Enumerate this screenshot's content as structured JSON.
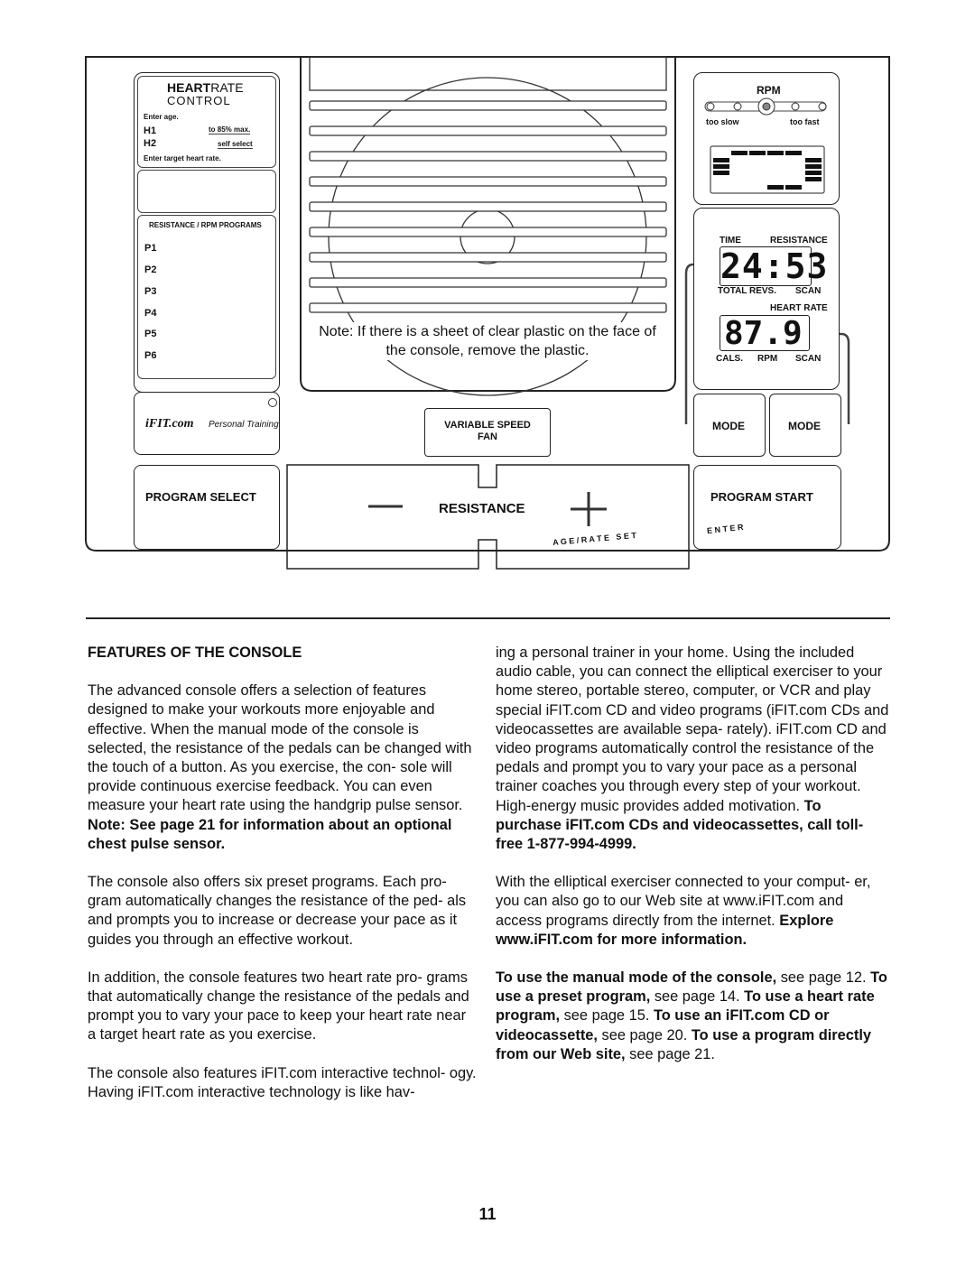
{
  "console": {
    "heart_rate": {
      "title_bold": "HEART",
      "title_light": "RATE",
      "subtitle": "CONTROL",
      "enter_age": "Enter age.",
      "h1": "H1",
      "h1_desc": "to 85% max.",
      "h2": "H2",
      "h2_desc": "self select",
      "enter_target": "Enter target heart rate."
    },
    "programs": {
      "title": "RESISTANCE / RPM PROGRAMS",
      "items": [
        "P1",
        "P2",
        "P3",
        "P4",
        "P5",
        "P6"
      ]
    },
    "note": "Note: If there is a sheet of clear plastic on the face of the console, remove the plastic.",
    "ifit_logo": "iFIT.com",
    "ifit_tagline": "Personal Training",
    "fan_button": "VARIABLE SPEED FAN",
    "program_select": "PROGRAM SELECT",
    "resistance": "RESISTANCE",
    "age_rate_set": "A G E / R A T E   S E T",
    "program_start": "PROGRAM START",
    "enter": "E N T E R",
    "rpm": {
      "title": "RPM",
      "too_slow": "too slow",
      "too_fast": "too fast"
    },
    "display": {
      "time": "TIME",
      "resistance": "RESISTANCE",
      "top_value": "24:53",
      "total_revs": "TOTAL REVS.",
      "scan1": "SCAN",
      "heart_rate": "HEART RATE",
      "bottom_value": "87.9",
      "cals": "CALS.",
      "rpm": "RPM",
      "scan2": "SCAN"
    },
    "mode_left": "MODE",
    "mode_right": "MODE"
  },
  "text": {
    "heading": "FEATURES OF THE CONSOLE",
    "p1": [
      "The advanced console offers a selection of features designed to make your workouts more enjoyable and effective. When the manual mode of the console is selected, the resistance of the pedals can be changed with the touch of a button. As you exercise, the con- sole will provide continuous exercise feedback. You can even measure your heart rate using the handgrip pulse sensor. ",
      "Note: See page 21 for information about an optional chest pulse sensor."
    ],
    "p2": "The console also offers six preset programs. Each pro- gram automatically changes the resistance of the ped- als and prompts you to increase or decrease your pace as it guides you through an effective workout.",
    "p3": "In addition, the console features two heart rate pro- grams that automatically change the resistance of the pedals and prompt you to vary your pace to keep your heart rate near a target heart rate as you exercise.",
    "p4": "The console also features iFIT.com interactive technol- ogy. Having iFIT.com interactive technology is like hav-",
    "p5": [
      "ing a personal trainer in your home. Using the included audio cable, you can connect the elliptical exerciser to your home stereo, portable stereo, computer, or VCR and play special iFIT.com CD and video programs (iFIT.com CDs and videocassettes are available sepa- rately). iFIT.com CD and video programs automatically control the resistance of the pedals and prompt you to vary your pace as a personal trainer coaches you through every step of your workout. High-energy music provides added motivation. ",
      "To purchase iFIT.com CDs and videocassettes, call toll-free 1-877-994-4999."
    ],
    "p6": [
      "With the elliptical exerciser connected to your comput- er, you can also go to our Web site at www.iFIT.com and access programs directly from the internet. ",
      "Explore www.iFIT.com for more information."
    ],
    "p7": [
      {
        "t": "To use the manual mode of the console,",
        "b": true
      },
      {
        "t": " see page 12. ",
        "b": false
      },
      {
        "t": "To use a preset program,",
        "b": true
      },
      {
        "t": " see page 14. ",
        "b": false
      },
      {
        "t": "To use a heart rate program,",
        "b": true
      },
      {
        "t": " see page 15. ",
        "b": false
      },
      {
        "t": "To use an iFIT.com CD or videocassette,",
        "b": true
      },
      {
        "t": " see page 20. ",
        "b": false
      },
      {
        "t": "To use a program directly from our Web site,",
        "b": true
      },
      {
        "t": " see page 21.",
        "b": false
      }
    ],
    "page_number": "11"
  }
}
